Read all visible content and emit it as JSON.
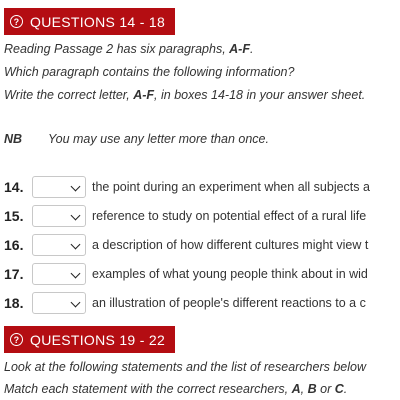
{
  "section1": {
    "title": "QUESTIONS 14 - 18",
    "instructions": [
      "Reading Passage 2 has six paragraphs, ",
      "Which paragraph contains the following information?",
      "Write the correct letter, "
    ],
    "range1": "A-F",
    "line1_end": ".",
    "range2": "A-F",
    "line3_end": ", in boxes 14-18 in your answer sheet.",
    "nb_label": "NB",
    "nb_text": "You may use any letter more than once."
  },
  "questions": [
    {
      "num": "14.",
      "text": "the point during an experiment when all subjects a"
    },
    {
      "num": "15.",
      "text": "reference to study on potential effect of a rural life"
    },
    {
      "num": "16.",
      "text": "a description of how different cultures might view t"
    },
    {
      "num": "17.",
      "text": "examples of what young people think about in wid"
    },
    {
      "num": "18.",
      "text": "an illustration of people's different reactions to a c"
    }
  ],
  "section2": {
    "title": "QUESTIONS 19 - 22",
    "line1": "Look at the following statements and the list of researchers below",
    "line2_start": "Match each statement with the correct researchers, ",
    "optA": "A",
    "sep1": ", ",
    "optB": "B",
    "sep2": " or ",
    "optC": "C",
    "line2_end": "."
  },
  "colors": {
    "header_bg": "#b40d12",
    "text": "#333333"
  },
  "icons": {
    "header_icon": "question-circle-icon",
    "select_icon": "chevron-down-icon"
  }
}
